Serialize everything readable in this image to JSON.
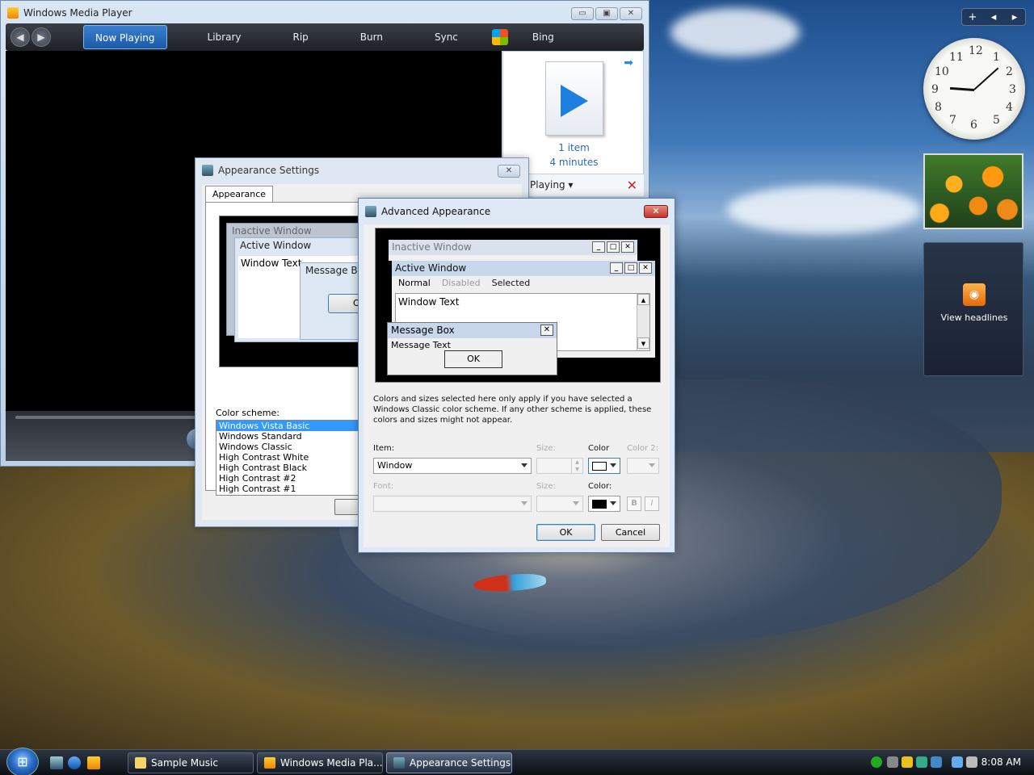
{
  "wmp": {
    "title": "Windows Media Player",
    "caption": {
      "minimize": "▭",
      "maximize": "▣",
      "close": "✕"
    },
    "tabs": [
      "Now Playing",
      "Library",
      "Rip",
      "Burn",
      "Sync",
      "Bing"
    ],
    "playlist": {
      "items": "1 item",
      "duration": "4 minutes",
      "footer": "Playing ▾"
    }
  },
  "appearance_settings": {
    "title": "Appearance Settings",
    "close": "✕",
    "tab": "Appearance",
    "preview": {
      "inactive": "Inactive Window",
      "active": "Active Window",
      "window_text": "Window Text",
      "message_box": "Message Bo",
      "ok": "O"
    },
    "color_scheme_label": "Color scheme:",
    "color_schemes": [
      "Windows Vista Basic",
      "Windows Standard",
      "Windows Classic",
      "High Contrast White",
      "High Contrast Black",
      "High Contrast #2",
      "High Contrast #1"
    ],
    "selected_scheme": "Windows Vista Basic",
    "ok_partial": "O"
  },
  "advanced_appearance": {
    "title": "Advanced Appearance",
    "close": "✕",
    "preview": {
      "inactive_window": "Inactive Window",
      "active_window": "Active Window",
      "menu_normal": "Normal",
      "menu_disabled": "Disabled",
      "menu_selected": "Selected",
      "window_text": "Window Text",
      "message_box": "Message Box",
      "message_text": "Message Text",
      "ok": "OK"
    },
    "info": "Colors and sizes selected here only apply if you have selected a Windows Classic color scheme. If any other scheme is applied, these colors and sizes might not appear.",
    "item_label": "Item:",
    "item_value": "Window",
    "size_label": "Size:",
    "color_label": "Color",
    "color2_label": "Color 2:",
    "font_label": "Font:",
    "font_size_label": "Size:",
    "font_color_label": "Color:",
    "bold": "B",
    "italic": "I",
    "ok": "OK",
    "cancel": "Cancel"
  },
  "sidebar": {
    "controls": [
      "+",
      "◂",
      "▸"
    ],
    "clock_numbers": [
      "12",
      "1",
      "2",
      "3",
      "4",
      "5",
      "6",
      "7",
      "8",
      "9",
      "10",
      "11"
    ],
    "feed_label": "View headlines"
  },
  "taskbar": {
    "buttons": [
      "Sample Music",
      "Windows Media Pla...",
      "Appearance Settings"
    ],
    "time": "8:08 AM"
  },
  "colors": {
    "accent": "#3399ff",
    "wmp_toolbar": "#1d2026",
    "close_red": "#c2352a"
  }
}
